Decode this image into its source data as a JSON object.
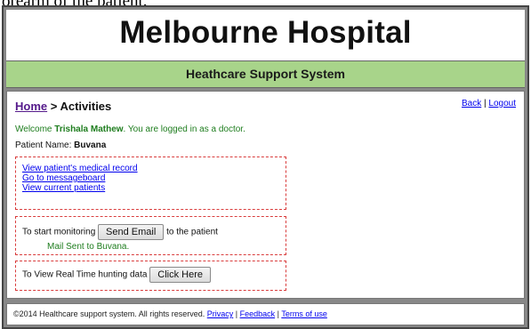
{
  "caption_fragment": "orearm of the patient.",
  "header": {
    "title": "Melbourne Hospital",
    "subtitle": "Heathcare Support System"
  },
  "breadcrumb": {
    "home": "Home",
    "separator": " > ",
    "current": "Activities"
  },
  "top_links": {
    "back": "Back",
    "sep": " | ",
    "logout": "Logout"
  },
  "welcome": {
    "prefix": "Welcome ",
    "name": "Trishala Mathew",
    "suffix": ". You are logged in as a doctor."
  },
  "patient": {
    "label": "Patient Name: ",
    "name": "Buvana"
  },
  "links": [
    "View patient's medical record",
    "Go to messageboard",
    "View current patients"
  ],
  "monitoring": {
    "prefix": "To start monitoring",
    "button": "Send Email",
    "suffix": "to the patient",
    "status": "Mail Sent to Buvana."
  },
  "realtime": {
    "prefix": "To View Real Time hunting data",
    "button": "Click Here"
  },
  "footer": {
    "copyright": "©2014 Healthcare support system. All rights reserved. ",
    "privacy": "Privacy",
    "sep": " | ",
    "feedback": "Feedback",
    "terms": "Terms of use"
  },
  "colors": {
    "subbar": "#a8d48a",
    "dash_border": "#d93c3c",
    "success_text": "#1e7d1e"
  }
}
